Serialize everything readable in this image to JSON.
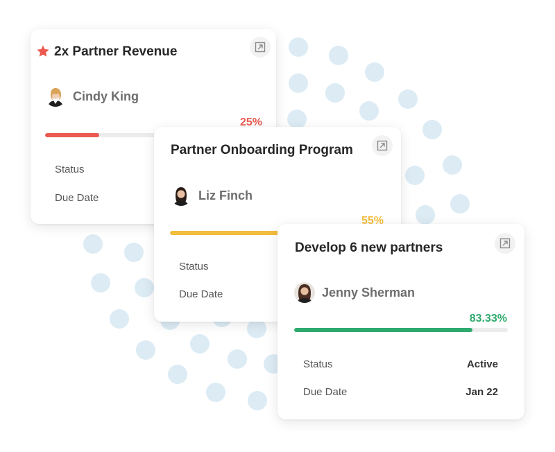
{
  "colors": {
    "red": "#ea5a50",
    "amber": "#f3bd3e",
    "green": "#2eaa6e",
    "dots": "#dcebf4"
  },
  "cards": [
    {
      "title": "2x Partner Revenue",
      "starred": true,
      "owner": "Cindy King",
      "progress_label": "25%",
      "progress": 0.25,
      "status_label": "Status",
      "due_label": "Due Date",
      "open_icon": "external-link-icon"
    },
    {
      "title": "Partner Onboarding Program",
      "owner": "Liz Finch",
      "progress_label": "55%",
      "progress": 0.55,
      "status_label": "Status",
      "due_label": "Due Date",
      "open_icon": "external-link-icon"
    },
    {
      "title": "Develop 6 new partners",
      "owner": "Jenny Sherman",
      "progress_label": "83.33%",
      "progress": 0.8333,
      "status_label": "Status",
      "status_value": "Active",
      "due_label": "Due Date",
      "due_value": "Jan 22",
      "open_icon": "external-link-icon"
    }
  ]
}
